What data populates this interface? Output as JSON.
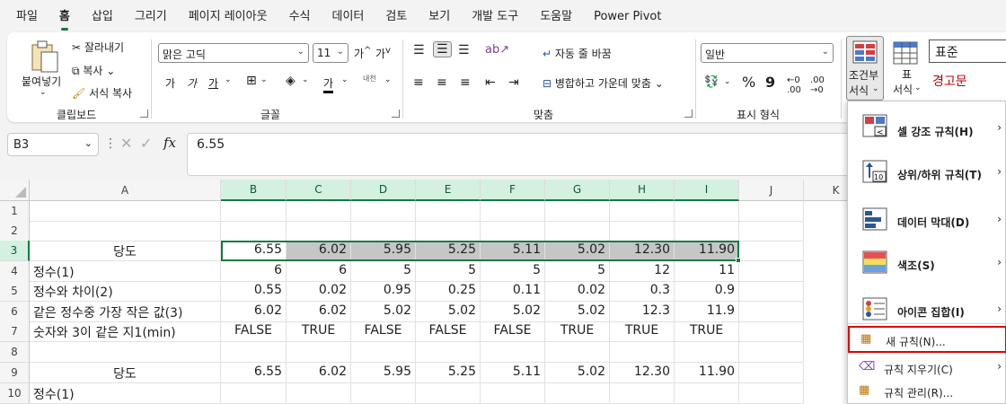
{
  "menu": [
    "파일",
    "홈",
    "삽입",
    "그리기",
    "페이지 레이아웃",
    "수식",
    "데이터",
    "검토",
    "보기",
    "개발 도구",
    "도움말",
    "Power Pivot"
  ],
  "ribbon": {
    "clipboard": {
      "paste": "붙여넣기",
      "cut": "잘라내기",
      "copy": "복사",
      "format_painter": "서식 복사",
      "label": "클립보드"
    },
    "font": {
      "name": "맑은 고딕",
      "size": "11",
      "grow": "가",
      "shrink": "가",
      "bold": "가",
      "italic": "가",
      "underline": "가",
      "font_color": "가",
      "phonetic": "내천",
      "label": "글꼴"
    },
    "alignment": {
      "wrap": "자동 줄 바꿈",
      "merge": "병합하고 가운데 맞춤",
      "label": "맞춤"
    },
    "number": {
      "format": "일반",
      "percent": "%",
      "comma": "9",
      "label": "표시 형식"
    },
    "styles": {
      "cond_format_l1": "조건부",
      "cond_format_l2": "서식",
      "table_format_l1": "표",
      "table_format_l2": "서식",
      "style_normal": "표준",
      "style_warning": "경고문"
    }
  },
  "namebox": "B3",
  "formula": "6.55",
  "columns": [
    {
      "label": "A"
    },
    {
      "label": "B"
    },
    {
      "label": "C"
    },
    {
      "label": "D"
    },
    {
      "label": "E"
    },
    {
      "label": "F"
    },
    {
      "label": "G"
    },
    {
      "label": "H"
    },
    {
      "label": "I"
    },
    {
      "label": "J"
    },
    {
      "label": "K"
    }
  ],
  "rows": [
    "1",
    "2",
    "3",
    "4",
    "5",
    "6",
    "7",
    "8",
    "9",
    "10"
  ],
  "cells": {
    "r3": {
      "a": "당도",
      "v": [
        "6.55",
        "6.02",
        "5.95",
        "5.25",
        "5.11",
        "5.02",
        "12.30",
        "11.90"
      ]
    },
    "r4": {
      "a": "정수(1)",
      "v": [
        "6",
        "6",
        "5",
        "5",
        "5",
        "5",
        "12",
        "11"
      ]
    },
    "r5": {
      "a": "정수와 차이(2)",
      "v": [
        "0.55",
        "0.02",
        "0.95",
        "0.25",
        "0.11",
        "0.02",
        "0.3",
        "0.9"
      ]
    },
    "r6": {
      "a": "같은 정수중 가장 작은 값(3)",
      "v": [
        "6.02",
        "6.02",
        "5.02",
        "5.02",
        "5.02",
        "5.02",
        "12.3",
        "11.9"
      ]
    },
    "r7": {
      "a": "숫자와 3이 같은 지1(min)",
      "v": [
        "FALSE",
        "TRUE",
        "FALSE",
        "FALSE",
        "FALSE",
        "TRUE",
        "TRUE",
        "TRUE"
      ]
    },
    "r9": {
      "a": "당도",
      "v": [
        "6.55",
        "6.02",
        "5.95",
        "5.25",
        "5.11",
        "5.02",
        "12.30",
        "11.90"
      ]
    },
    "r10": {
      "a": "정수(1)"
    }
  },
  "dropdown": {
    "highlight": "셀 강조 규칙(H)",
    "topbottom": "상위/하위 규칙(T)",
    "databar": "데이터 막대(D)",
    "colorscale": "색조(S)",
    "iconset": "아이콘 집합(I)",
    "newrule": "새 규칙(N)...",
    "clear": "규칙 지우기(C)",
    "manage": "규칙 관리(R)..."
  },
  "colors": {
    "accent": "#107c41",
    "highlight_fill": "#c6c6c6",
    "warning": "#c00000",
    "callout": "#e00000"
  }
}
